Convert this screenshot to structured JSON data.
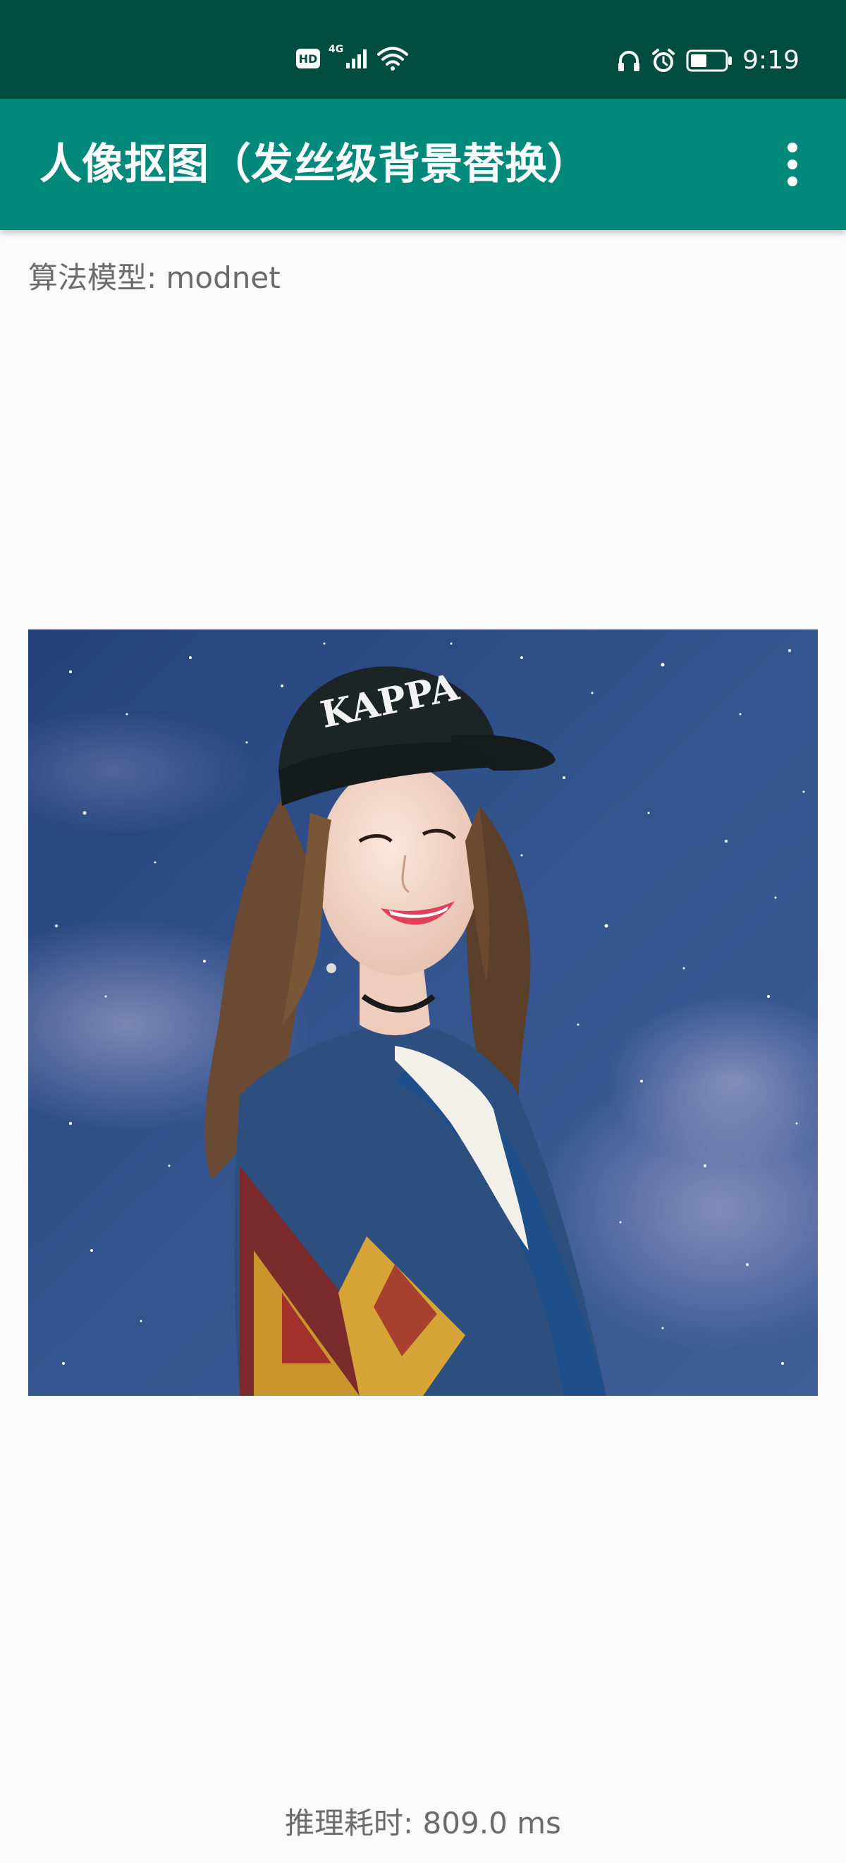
{
  "status_bar": {
    "hd_badge": "HD",
    "network_type": "4G",
    "time": "9:19",
    "icons": [
      "signal-icon",
      "wifi-icon",
      "headphones-icon",
      "alarm-icon",
      "battery-icon"
    ]
  },
  "app_bar": {
    "title": "人像抠图（发丝级背景替换）",
    "menu_icon": "more-vert-icon"
  },
  "content": {
    "model_label": "算法模型: modnet",
    "inference_time": "推理耗时: 809.0 ms",
    "image": {
      "alt": "portrait on starry sky",
      "cap_text": "KAPPA"
    }
  },
  "colors": {
    "status_bar": "#004d40",
    "app_bar": "#00897b",
    "background": "#fafafa",
    "text_secondary": "#6b6b6b"
  }
}
